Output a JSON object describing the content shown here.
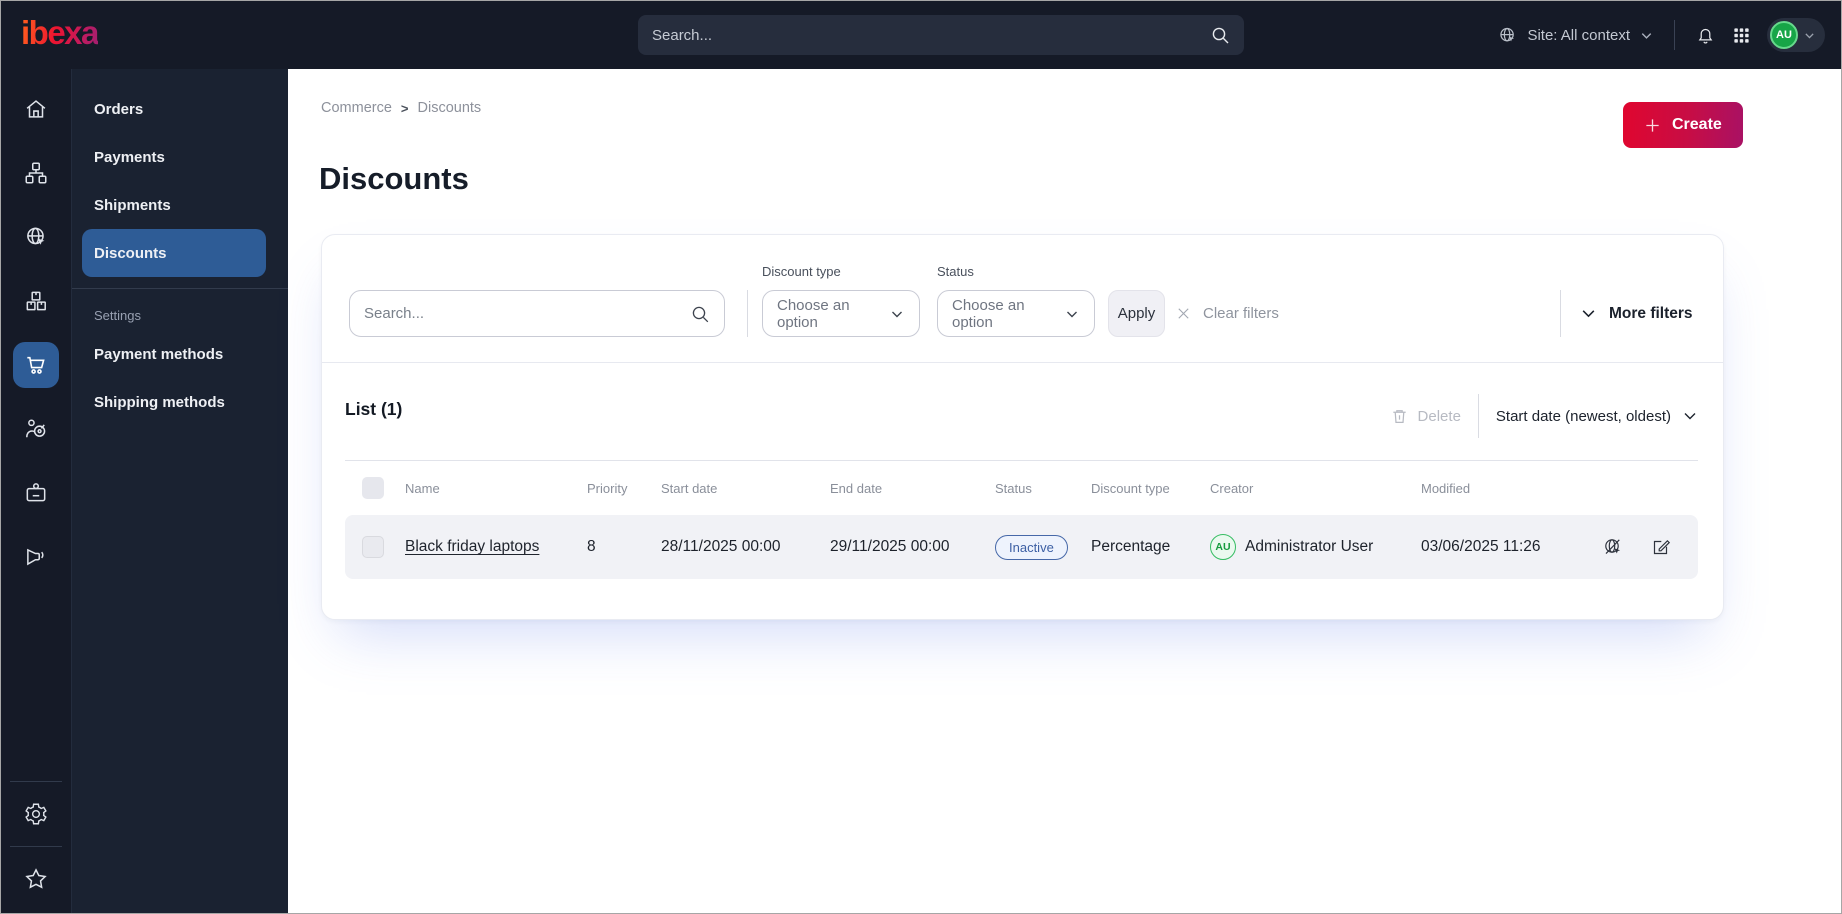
{
  "topbar": {
    "logo_text": "ibexa",
    "search_placeholder": "Search...",
    "site_context_label": "Site: All context",
    "user_initials": "AU"
  },
  "sidebar": {
    "rail_icons": [
      "home",
      "content-tree",
      "site",
      "products",
      "commerce",
      "personalization",
      "corporate",
      "campaigns"
    ],
    "rail_bottom_icons": [
      "settings",
      "bookmarks"
    ],
    "active_rail_icon": "commerce",
    "menu": [
      {
        "label": "Orders",
        "active": false
      },
      {
        "label": "Payments",
        "active": false
      },
      {
        "label": "Shipments",
        "active": false
      },
      {
        "label": "Discounts",
        "active": true
      }
    ],
    "settings_label": "Settings",
    "settings_menu": [
      {
        "label": "Payment methods"
      },
      {
        "label": "Shipping methods"
      }
    ]
  },
  "breadcrumb": {
    "items": [
      "Commerce",
      "Discounts"
    ],
    "separator": ">"
  },
  "page": {
    "title": "Discounts",
    "create_label": "Create"
  },
  "filters": {
    "search_placeholder": "Search...",
    "discount_type_label": "Discount type",
    "discount_type_value": "Choose an option",
    "status_label": "Status",
    "status_value": "Choose an option",
    "apply_label": "Apply",
    "clear_filters_label": "Clear filters",
    "more_filters_label": "More filters"
  },
  "list": {
    "title": "List (1)",
    "delete_label": "Delete",
    "sort_label": "Start date (newest, oldest)",
    "columns": [
      "Name",
      "Priority",
      "Start date",
      "End date",
      "Status",
      "Discount type",
      "Creator",
      "Modified"
    ],
    "rows": [
      {
        "name": "Black friday laptops",
        "priority": "8",
        "start_date": "28/11/2025 00:00",
        "end_date": "29/11/2025 00:00",
        "status": "Inactive",
        "discount_type": "Percentage",
        "creator_initials": "AU",
        "creator_name": "Administrator User",
        "modified": "03/06/2025 11:26"
      }
    ]
  },
  "colors": {
    "topbar_bg": "#151a27",
    "menu_bg": "#1a2231",
    "active_item_blue": "#2e5c96",
    "create_gradient_start": "#e0062f",
    "create_gradient_end": "#a91164",
    "status_inactive_blue": "#3c5fa4",
    "creator_green": "#149b3d",
    "row_bg": "#f1f2f6"
  }
}
